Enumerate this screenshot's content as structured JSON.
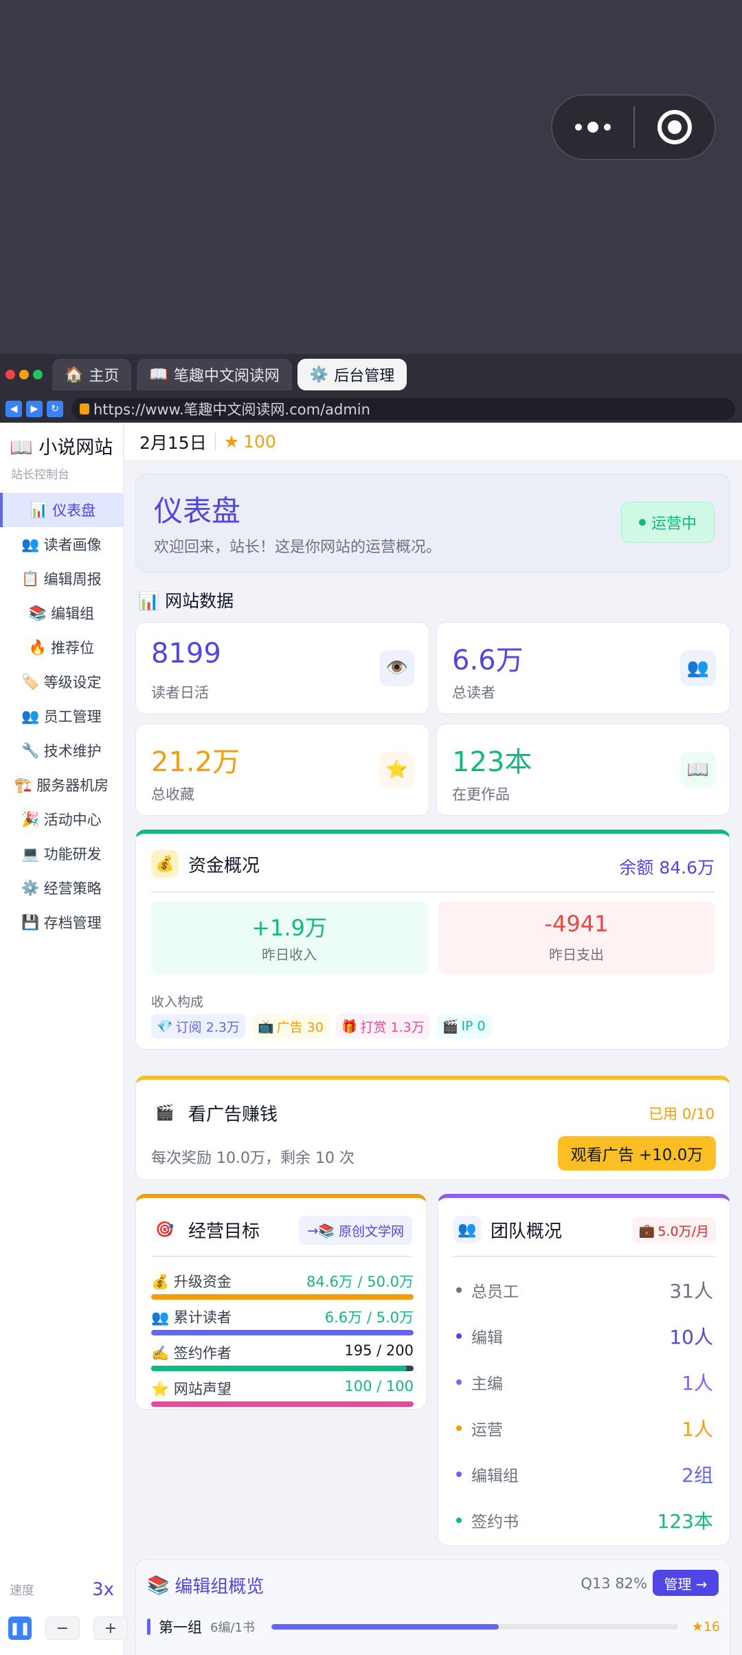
{
  "browser": {
    "tabs": [
      {
        "icon": "🏠",
        "label": "主页"
      },
      {
        "icon": "📖",
        "label": "笔趣中文阅读网"
      },
      {
        "icon": "⚙️",
        "label": "后台管理"
      }
    ],
    "url": "https://www.笔趣中文阅读网.com/admin"
  },
  "sidebar": {
    "brand": "📖 小说网站",
    "subtitle": "站长控制台",
    "items": [
      {
        "icon": "📊",
        "label": "仪表盘"
      },
      {
        "icon": "👥",
        "label": "读者画像"
      },
      {
        "icon": "📋",
        "label": "编辑周报"
      },
      {
        "icon": "📚",
        "label": "编辑组"
      },
      {
        "icon": "🔥",
        "label": "推荐位"
      },
      {
        "icon": "🏷️",
        "label": "等级设定"
      },
      {
        "icon": "👥",
        "label": "员工管理"
      },
      {
        "icon": "🔧",
        "label": "技术维护"
      },
      {
        "icon": "🏗️",
        "label": "服务器机房"
      },
      {
        "icon": "🎉",
        "label": "活动中心"
      },
      {
        "icon": "💻",
        "label": "功能研发"
      },
      {
        "icon": "⚙️",
        "label": "经营策略"
      },
      {
        "icon": "💾",
        "label": "存档管理"
      }
    ],
    "speed_label": "速度",
    "speed_value": "3x"
  },
  "topbar": {
    "date": "2月15日",
    "stars": "100"
  },
  "hero": {
    "title": "仪表盘",
    "subtitle": "欢迎回来，站长！这是你网站的运营概况。",
    "status": "运营中"
  },
  "section_title": "📊 网站数据",
  "stats": [
    {
      "value": "8199",
      "label": "读者日活",
      "icon": "👁️"
    },
    {
      "value": "6.6万",
      "label": "总读者",
      "icon": "👥"
    },
    {
      "value": "21.2万",
      "label": "总收藏",
      "icon": "⭐"
    },
    {
      "value": "123本",
      "label": "在更作品",
      "icon": "📖"
    }
  ],
  "funds": {
    "title": "资金概况",
    "balance": "余额 84.6万",
    "income_value": "+1.9万",
    "income_label": "昨日收入",
    "expense_value": "-4941",
    "expense_label": "昨日支出",
    "composition_label": "收入构成",
    "chips": [
      {
        "icon": "💎",
        "text": "订阅 2.3万"
      },
      {
        "icon": "📺",
        "text": "广告 30"
      },
      {
        "icon": "🎁",
        "text": "打赏 1.3万"
      },
      {
        "icon": "🎬",
        "text": "IP 0"
      }
    ]
  },
  "ad": {
    "title": "看广告赚钱",
    "used": "已用 0/10",
    "desc": "每次奖励 10.0万，剩余 10 次",
    "button": "观看广告 +10.0万"
  },
  "goals": {
    "title": "经营目标",
    "link": "原创文学网",
    "items": [
      {
        "icon": "💰",
        "label": "升级资金",
        "value": "84.6万 / 50.0万",
        "progress": 1.0,
        "color": "#f59e0b"
      },
      {
        "icon": "👥",
        "label": "累计读者",
        "value": "6.6万 / 5.0万",
        "progress": 1.0,
        "color": "#6366f1"
      },
      {
        "icon": "✍️",
        "label": "签约作者",
        "value": "195 / 200",
        "progress": 0.975,
        "color": "#10b981"
      },
      {
        "icon": "⭐",
        "label": "网站声望",
        "value": "100 / 100",
        "progress": 1.0,
        "color": "#ec4899"
      }
    ]
  },
  "team": {
    "title": "团队概况",
    "salary": "5.0万/月",
    "rows": [
      {
        "label": "总员工",
        "value": "31人",
        "color": "#6b7280"
      },
      {
        "label": "编辑",
        "value": "10人",
        "color": "#4f46e5"
      },
      {
        "label": "主编",
        "value": "1人",
        "color": "#8b5cf6"
      },
      {
        "label": "运营",
        "value": "1人",
        "color": "#f59e0b"
      },
      {
        "label": "编辑组",
        "value": "2组",
        "color": "#6366f1"
      },
      {
        "label": "签约书",
        "value": "123本",
        "color": "#10b981"
      }
    ]
  },
  "editor_groups": {
    "title": "编辑组概览",
    "quality": "Q13 82%",
    "manage": "管理 →",
    "row": {
      "name": "第一组",
      "stats": "6编/1书",
      "progress": 0.56,
      "score": "★16"
    }
  },
  "colors": {
    "accent": "#4f46e5",
    "success": "#10b981",
    "warning": "#f59e0b",
    "danger": "#ef4444"
  }
}
